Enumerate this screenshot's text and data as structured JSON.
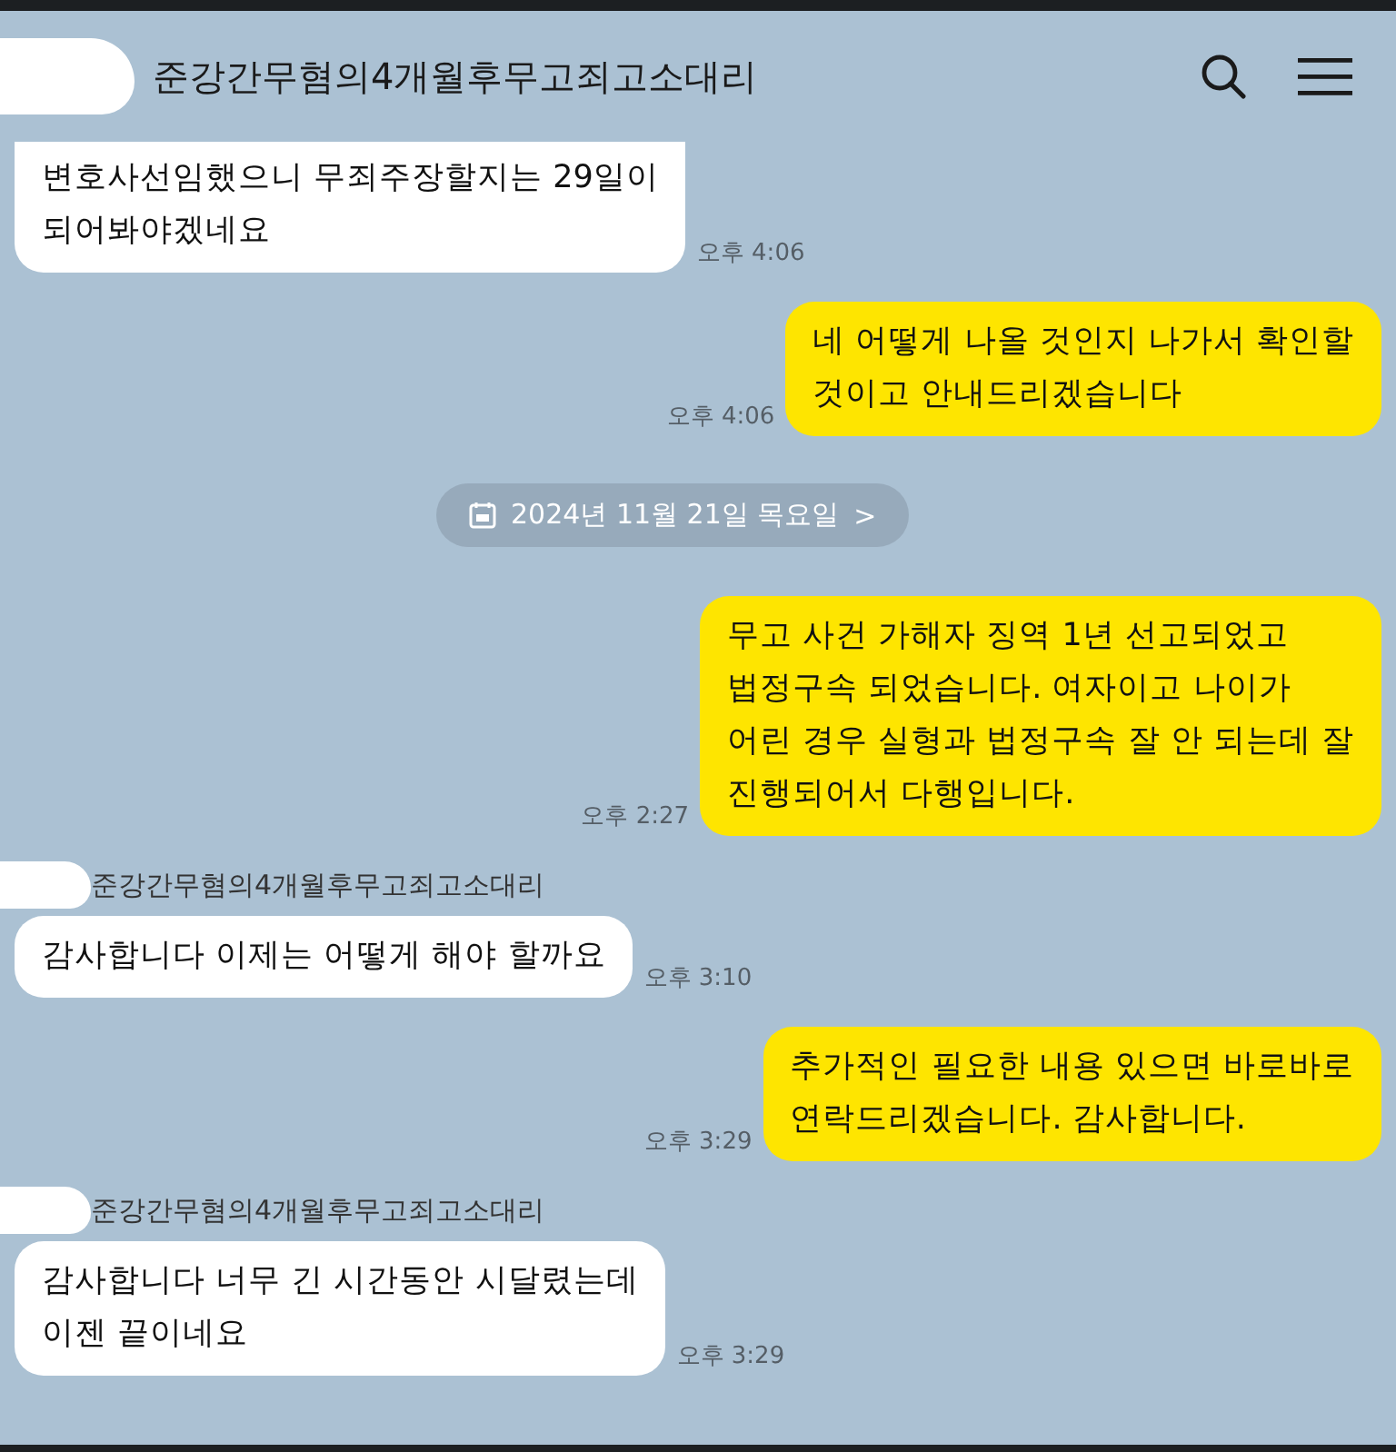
{
  "header": {
    "title": "준강간무혐의4개월후무고죄고소대리",
    "redacted": true
  },
  "messages": [
    {
      "kind": "incoming",
      "clipped": true,
      "text": "변호사선임했으니 무죄주장할지는 29일이\n되어봐야겠네요",
      "time": "오후 4:06"
    },
    {
      "kind": "outgoing",
      "text": "네 어떻게 나올 것인지 나가서 확인할\n것이고 안내드리겠습니다",
      "time": "오후 4:06"
    },
    {
      "kind": "date",
      "text": "2024년 11월 21일 목요일",
      "chevron": ">"
    },
    {
      "kind": "outgoing",
      "text": "무고 사건 가해자 징역 1년 선고되었고\n법정구속 되었습니다. 여자이고 나이가\n어린 경우 실형과 법정구속 잘 안 되는데 잘\n진행되어서 다행입니다.",
      "time": "오후 2:27"
    },
    {
      "kind": "incoming",
      "sender": "준강간무혐의4개월후무고죄고소대리",
      "text": "감사합니다 이제는 어떻게 해야 할까요",
      "time": "오후 3:10"
    },
    {
      "kind": "outgoing",
      "text": "추가적인 필요한 내용 있으면 바로바로\n연락드리겠습니다. 감사합니다.",
      "time": "오후 3:29"
    },
    {
      "kind": "incoming",
      "sender": "준강간무혐의4개월후무고죄고소대리",
      "text": "감사합니다 너무 긴 시간동안 시달렸는데\n이젠 끝이네요",
      "time": "오후 3:29"
    }
  ]
}
